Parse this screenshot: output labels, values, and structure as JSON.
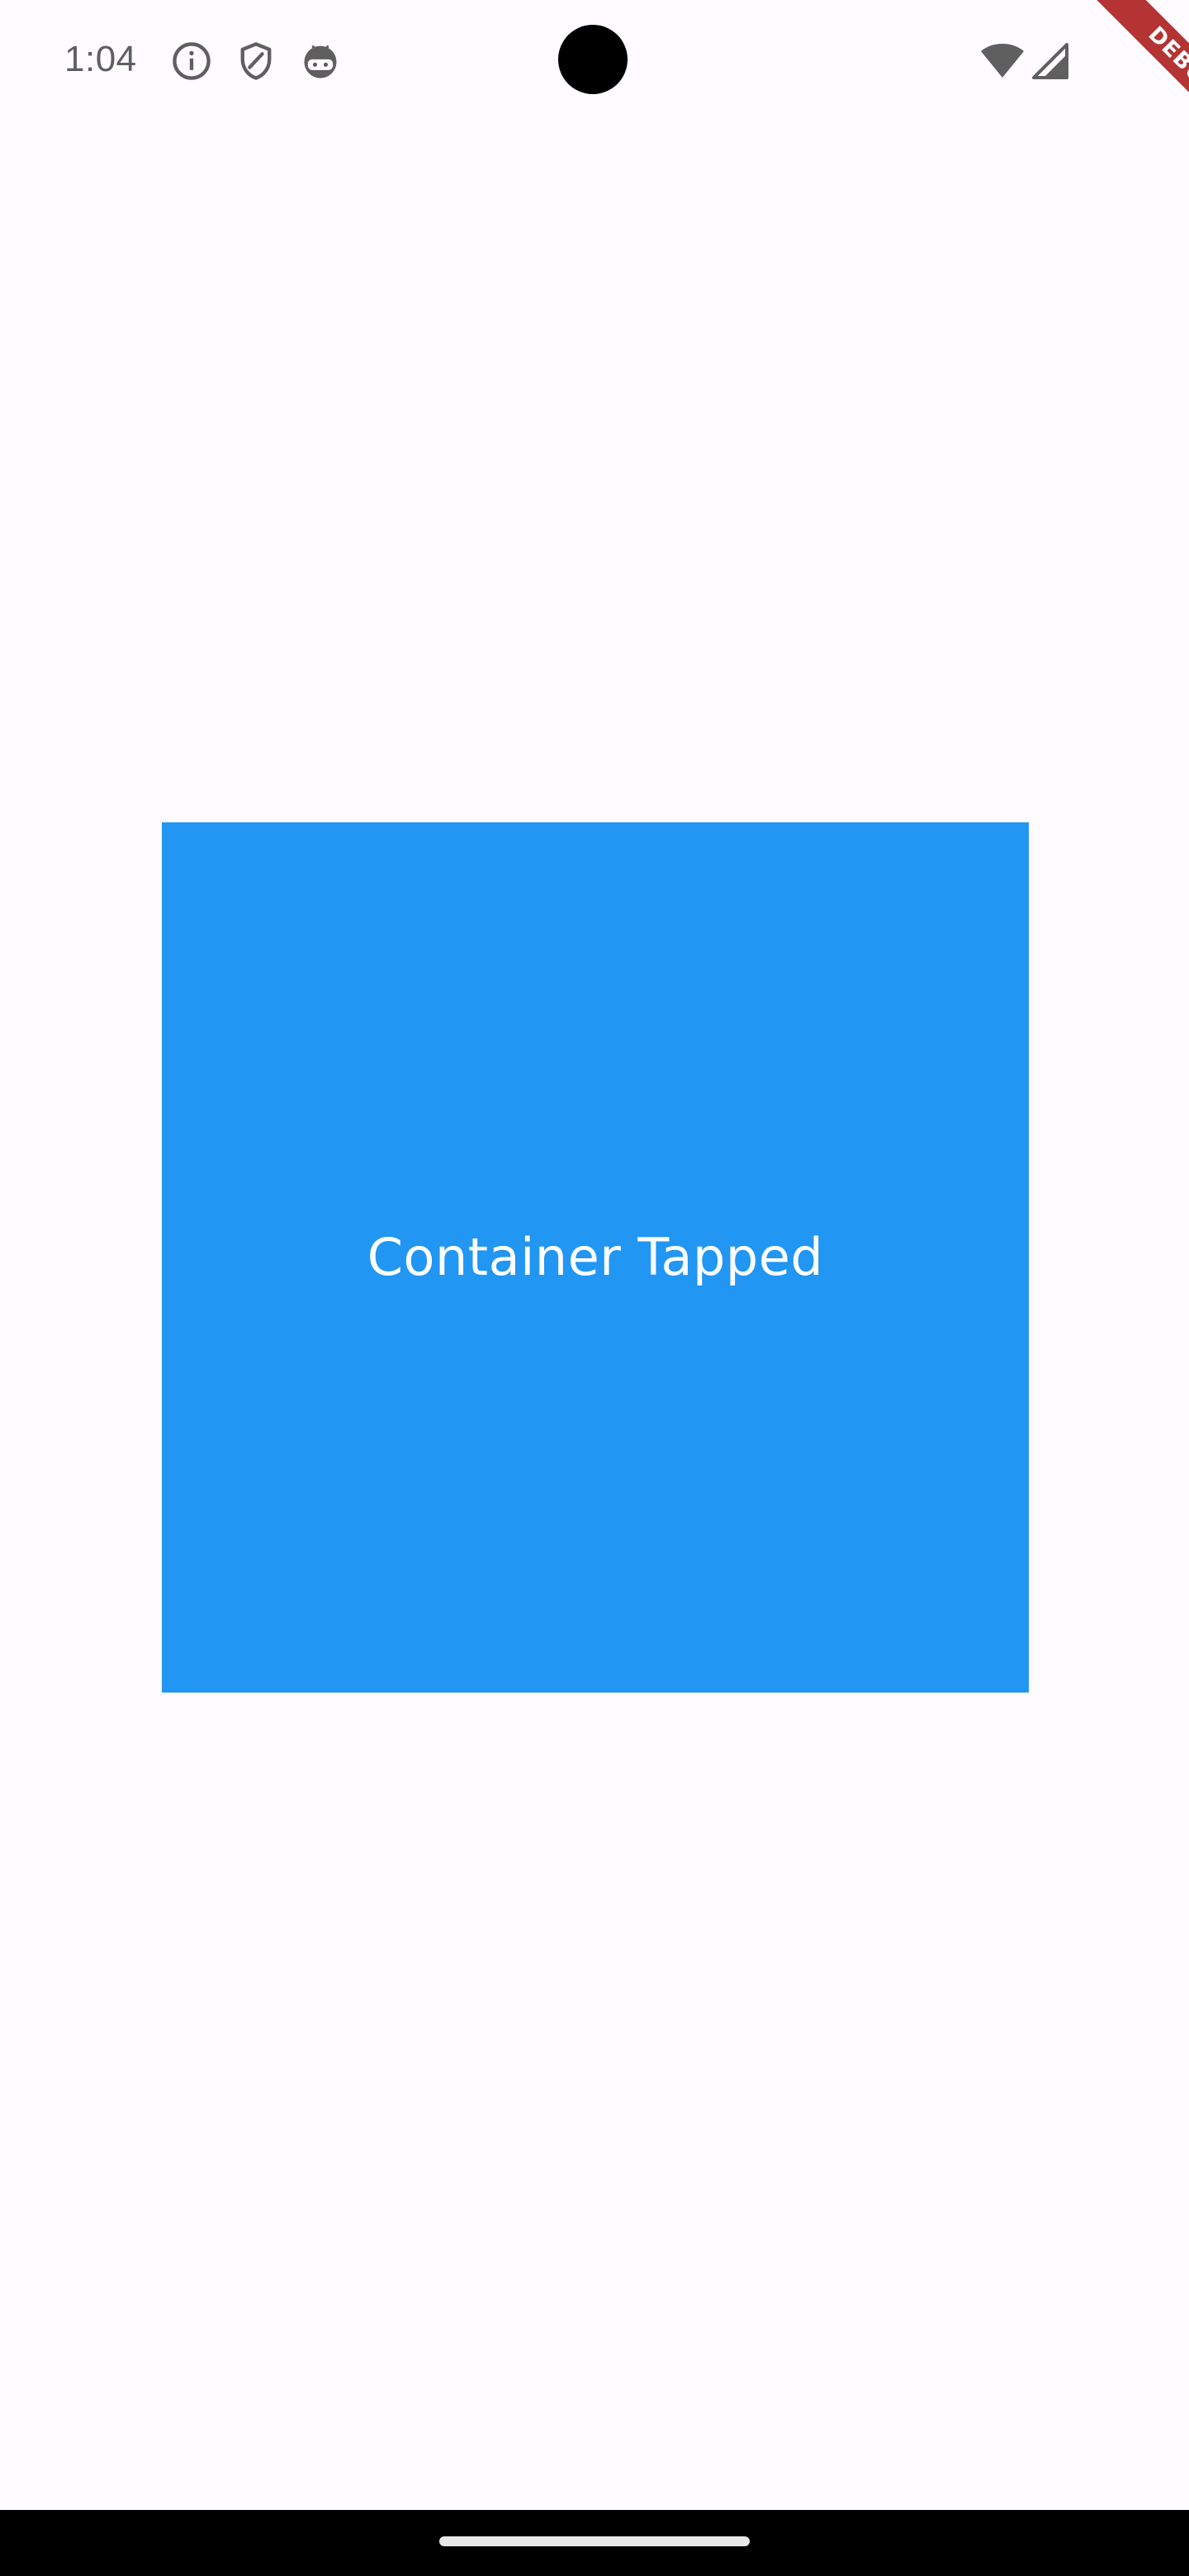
{
  "status_bar": {
    "time": "1:04",
    "icons": [
      "info-icon",
      "shield-icon",
      "android-robot-icon",
      "wifi-icon",
      "cell-signal-icon"
    ]
  },
  "debug_banner": {
    "label": "DEBUG",
    "color": "#B43434"
  },
  "container": {
    "label": "Container Tapped",
    "color": "#2196F3",
    "text_color": "#FFFFFF"
  },
  "page": {
    "background": "#FFFBFE"
  }
}
